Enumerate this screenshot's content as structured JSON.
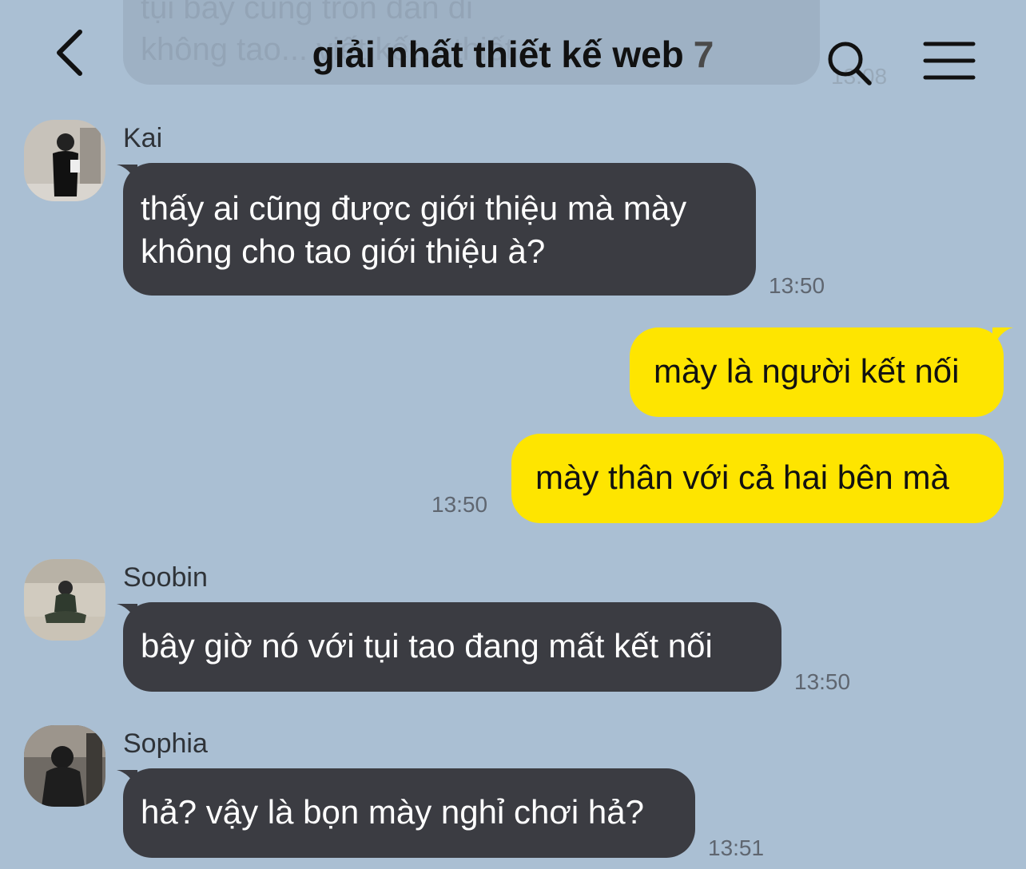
{
  "header": {
    "title": "giải nhất thiết kế web",
    "member_count": "7"
  },
  "ghost": {
    "text": "tụi bây cũng trốn dần đi\nkhông tao... viết kết... thiết",
    "time": "13:08"
  },
  "messages": [
    {
      "sender": "Kai",
      "text_lines": [
        "thấy ai cũng được giới thiệu mà mày",
        "không cho tao giới thiệu à?"
      ],
      "time": "13:50",
      "direction": "incoming"
    },
    {
      "text": "mày là người kết nối",
      "direction": "outgoing"
    },
    {
      "text": "mày thân với cả hai bên mà",
      "time": "13:50",
      "direction": "outgoing"
    },
    {
      "sender": "Soobin",
      "text": "bây giờ nó với tụi tao đang mất kết nối",
      "time": "13:50",
      "direction": "incoming"
    },
    {
      "sender": "Sophia",
      "text": "hả? vậy là bọn mày nghỉ chơi hả?",
      "time": "13:51",
      "direction": "incoming"
    }
  ],
  "colors": {
    "background": "#aabfd3",
    "incoming_bubble": "#3b3c42",
    "outgoing_bubble": "#fee500"
  },
  "icons": [
    "chevron-left-icon",
    "search-icon",
    "menu-icon"
  ]
}
